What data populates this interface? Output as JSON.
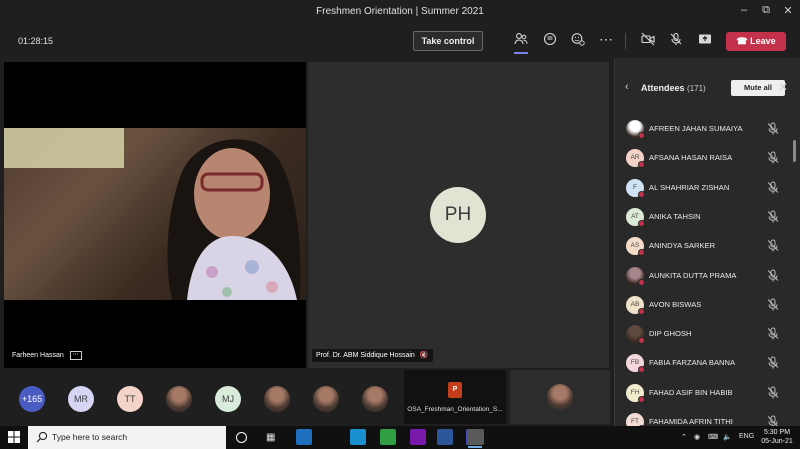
{
  "window": {
    "title": "Freshmen Orientation | Summer 2021",
    "controls": [
      "minimize-icon",
      "restore-icon",
      "close-icon"
    ]
  },
  "toolbar": {
    "timer": "01:28:15",
    "take_control_label": "Take control",
    "leave_label": "Leave",
    "icons": [
      "people-icon",
      "chat-icon",
      "reactions-icon",
      "more-icon",
      "camera-off-icon",
      "mic-off-icon",
      "share-tray-icon"
    ]
  },
  "stage": {
    "video_tile": {
      "name": "Farheen Hassan"
    },
    "avatar_tile": {
      "initials": "PH",
      "name": "Prof. Dr. ABM Siddique Hossain"
    }
  },
  "gallery": {
    "overflow_count": "+165",
    "avatars": [
      {
        "kind": "initials",
        "text": "MR",
        "color": "#d6d6f4"
      },
      {
        "kind": "initials",
        "text": "TT",
        "color": "#f4d3c9"
      },
      {
        "kind": "photo",
        "text": ""
      },
      {
        "kind": "initials",
        "text": "MJ",
        "color": "#d9ecd9"
      },
      {
        "kind": "photo",
        "text": ""
      },
      {
        "kind": "photo",
        "text": ""
      },
      {
        "kind": "photo",
        "text": ""
      }
    ],
    "shared_file": "OSA_Freshman_Orientation_S..."
  },
  "panel": {
    "title": "Attendees",
    "count": "(171)",
    "mute_all_label": "Mute all",
    "attendees": [
      {
        "name": "AFREEN JAHAN SUMAIYA",
        "initials": "",
        "color": "#ffffff",
        "photo": true
      },
      {
        "name": "AFSANA HASAN RAISA",
        "initials": "AR",
        "color": "#f3d2c8",
        "photo": false
      },
      {
        "name": "AL SHAHRIAR ZISHAN",
        "initials": "F",
        "color": "#cfe3f5",
        "photo": false
      },
      {
        "name": "ANIKA TAHSIN",
        "initials": "AT",
        "color": "#dbe9d6",
        "photo": false
      },
      {
        "name": "ANINDYA SARKER",
        "initials": "AS",
        "color": "#f6dcc8",
        "photo": false
      },
      {
        "name": "AUNKITA DUTTA PRAMA",
        "initials": "",
        "color": "#a8858a",
        "photo": true
      },
      {
        "name": "AVON BISWAS",
        "initials": "AB",
        "color": "#efe2c8",
        "photo": false
      },
      {
        "name": "DIP GHOSH",
        "initials": "",
        "color": "#5e4a3e",
        "photo": true
      },
      {
        "name": "FABIA FARZANA BANNA",
        "initials": "FB",
        "color": "#f4d7dc",
        "photo": false
      },
      {
        "name": "FAHAD ASIF BIN HABIB",
        "initials": "FH",
        "color": "#f1eccc",
        "photo": false
      },
      {
        "name": "FAHAMIDA AFRIN TITHI",
        "initials": "FT",
        "color": "#f3dcd3",
        "photo": false
      }
    ]
  },
  "taskbar": {
    "search_placeholder": "Type here to search",
    "language": "ENG",
    "time": "5:30 PM",
    "date": "05-Jun-21",
    "apps": [
      {
        "icon": "task-view-icon",
        "color": "#101010"
      },
      {
        "icon": "file-explorer-icon",
        "color": "#1f6fbf"
      },
      {
        "icon": "edge-icon",
        "color": "#1a8fd0"
      },
      {
        "icon": "chrome-icon",
        "color": "#2f9e44"
      },
      {
        "icon": "onenote-icon",
        "color": "#7719aa"
      },
      {
        "icon": "word-icon",
        "color": "#2b579a"
      },
      {
        "icon": "teams-icon",
        "color": "#464eb8"
      },
      {
        "icon": "snipping-tool-icon",
        "color": "#5a5a5a"
      }
    ]
  },
  "colors": {
    "accent": "#7b83eb",
    "leave": "#c4314b",
    "background": "#1f1f1f",
    "panel": "#292929"
  }
}
